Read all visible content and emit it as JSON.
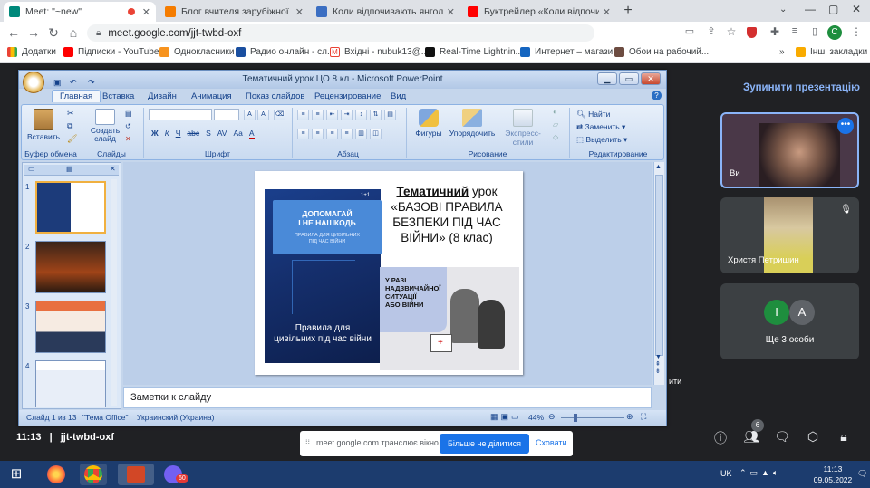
{
  "browser": {
    "tabs": [
      {
        "title": "Meet: \"~new\"",
        "active": true,
        "favicon_color": "#00897b"
      },
      {
        "title": "Блог вчителя зарубіжної літера",
        "active": false,
        "favicon_color": "#f57c00"
      },
      {
        "title": "Коли відпочивають янголи – Ш",
        "active": false,
        "favicon_color": "#3b6ec2"
      },
      {
        "title": "Буктрейлер «Коли відпочивают",
        "active": false,
        "favicon_color": "#ff0000"
      }
    ],
    "new_tab": "+",
    "url": "meet.google.com/jjt-twbd-oxf",
    "profile_initial": "C",
    "bookmarks": [
      "Додатки",
      "Підписки - YouTube",
      "Однокласники",
      "Радио онлайн - сл...",
      "Вхідні - nubuk13@...",
      "Real-Time Lightnin...",
      "Интернет – магази...",
      "Обои на рабочий...",
      "Інші закладки"
    ]
  },
  "ppt": {
    "window_title": "Тематичний урок ЦО 8 кл - Microsoft PowerPoint",
    "ribbon_tabs": [
      "Главная",
      "Вставка",
      "Дизайн",
      "Анимация",
      "Показ слайдов",
      "Рецензирование",
      "Вид"
    ],
    "groups": {
      "clipboard": {
        "label": "Буфер обмена",
        "paste": "Вставить"
      },
      "slides": {
        "label": "Слайды",
        "new_slide_1": "Создать",
        "new_slide_2": "слайд"
      },
      "font": {
        "label": "Шрифт"
      },
      "paragraph": {
        "label": "Абзац"
      },
      "drawing": {
        "label": "Рисование",
        "shapes": "Фигуры",
        "arrange": "Упорядочить",
        "styles": "Экспресс-стили"
      },
      "editing": {
        "label": "Редактирование",
        "find": "Найти",
        "replace": "Заменить",
        "select": "Выделить"
      }
    },
    "font_buttons": [
      "Ж",
      "К",
      "Ч",
      "abc",
      "S",
      "AV",
      "Aa",
      "A"
    ],
    "thumbnails": [
      "1",
      "2",
      "3",
      "4"
    ],
    "notes_placeholder": "Заметки к слайду",
    "status": {
      "slide": "Слайд 1 из 13",
      "theme": "\"Тема Office\"",
      "language": "Украинский (Украина)",
      "zoom": "44%"
    }
  },
  "slide": {
    "poster_head_1": "ДОПОМАГАЙ",
    "poster_head_2": "І НЕ НАШКОДЬ",
    "poster_sub": "ПРАВИЛА ДЛЯ ЦИВІЛЬНИХ ПІД ЧАС ВІЙНИ",
    "poster_badge": "1+1",
    "poster_foot_1": "Правила для",
    "poster_foot_2": "цивільних під час війни",
    "title_bold": "Тематичний",
    "title_rest": " урок «БАЗОВІ ПРАВИЛА БЕЗПЕКИ ПІД ЧАС ВІЙНИ» (8 клас)",
    "scene_label_1": "У РАЗІ",
    "scene_label_2": "НАДЗВИЧАЙНОЇ",
    "scene_label_3": "СИТУАЦІЇ",
    "scene_label_4": "АБО ВІЙНИ"
  },
  "meet": {
    "stop_presenting": "Зупинити презентацію",
    "participants": [
      {
        "name": "Ви"
      },
      {
        "name": "Христя Петришин"
      }
    ],
    "others_label": "Ще 3 особи",
    "others_avatars": [
      "І",
      "А"
    ],
    "time": "11:13",
    "meeting_code": "jjt-twbd-oxf",
    "people_count": "6",
    "side_snippet": "ити",
    "sharing_message": "meet.google.com транслює вікно.",
    "stop_sharing": "Більше не ділитися",
    "hide": "Сховати"
  },
  "taskbar": {
    "lang": "UK",
    "time": "11:13",
    "date": "09.05.2022",
    "viber_badge": "60"
  }
}
